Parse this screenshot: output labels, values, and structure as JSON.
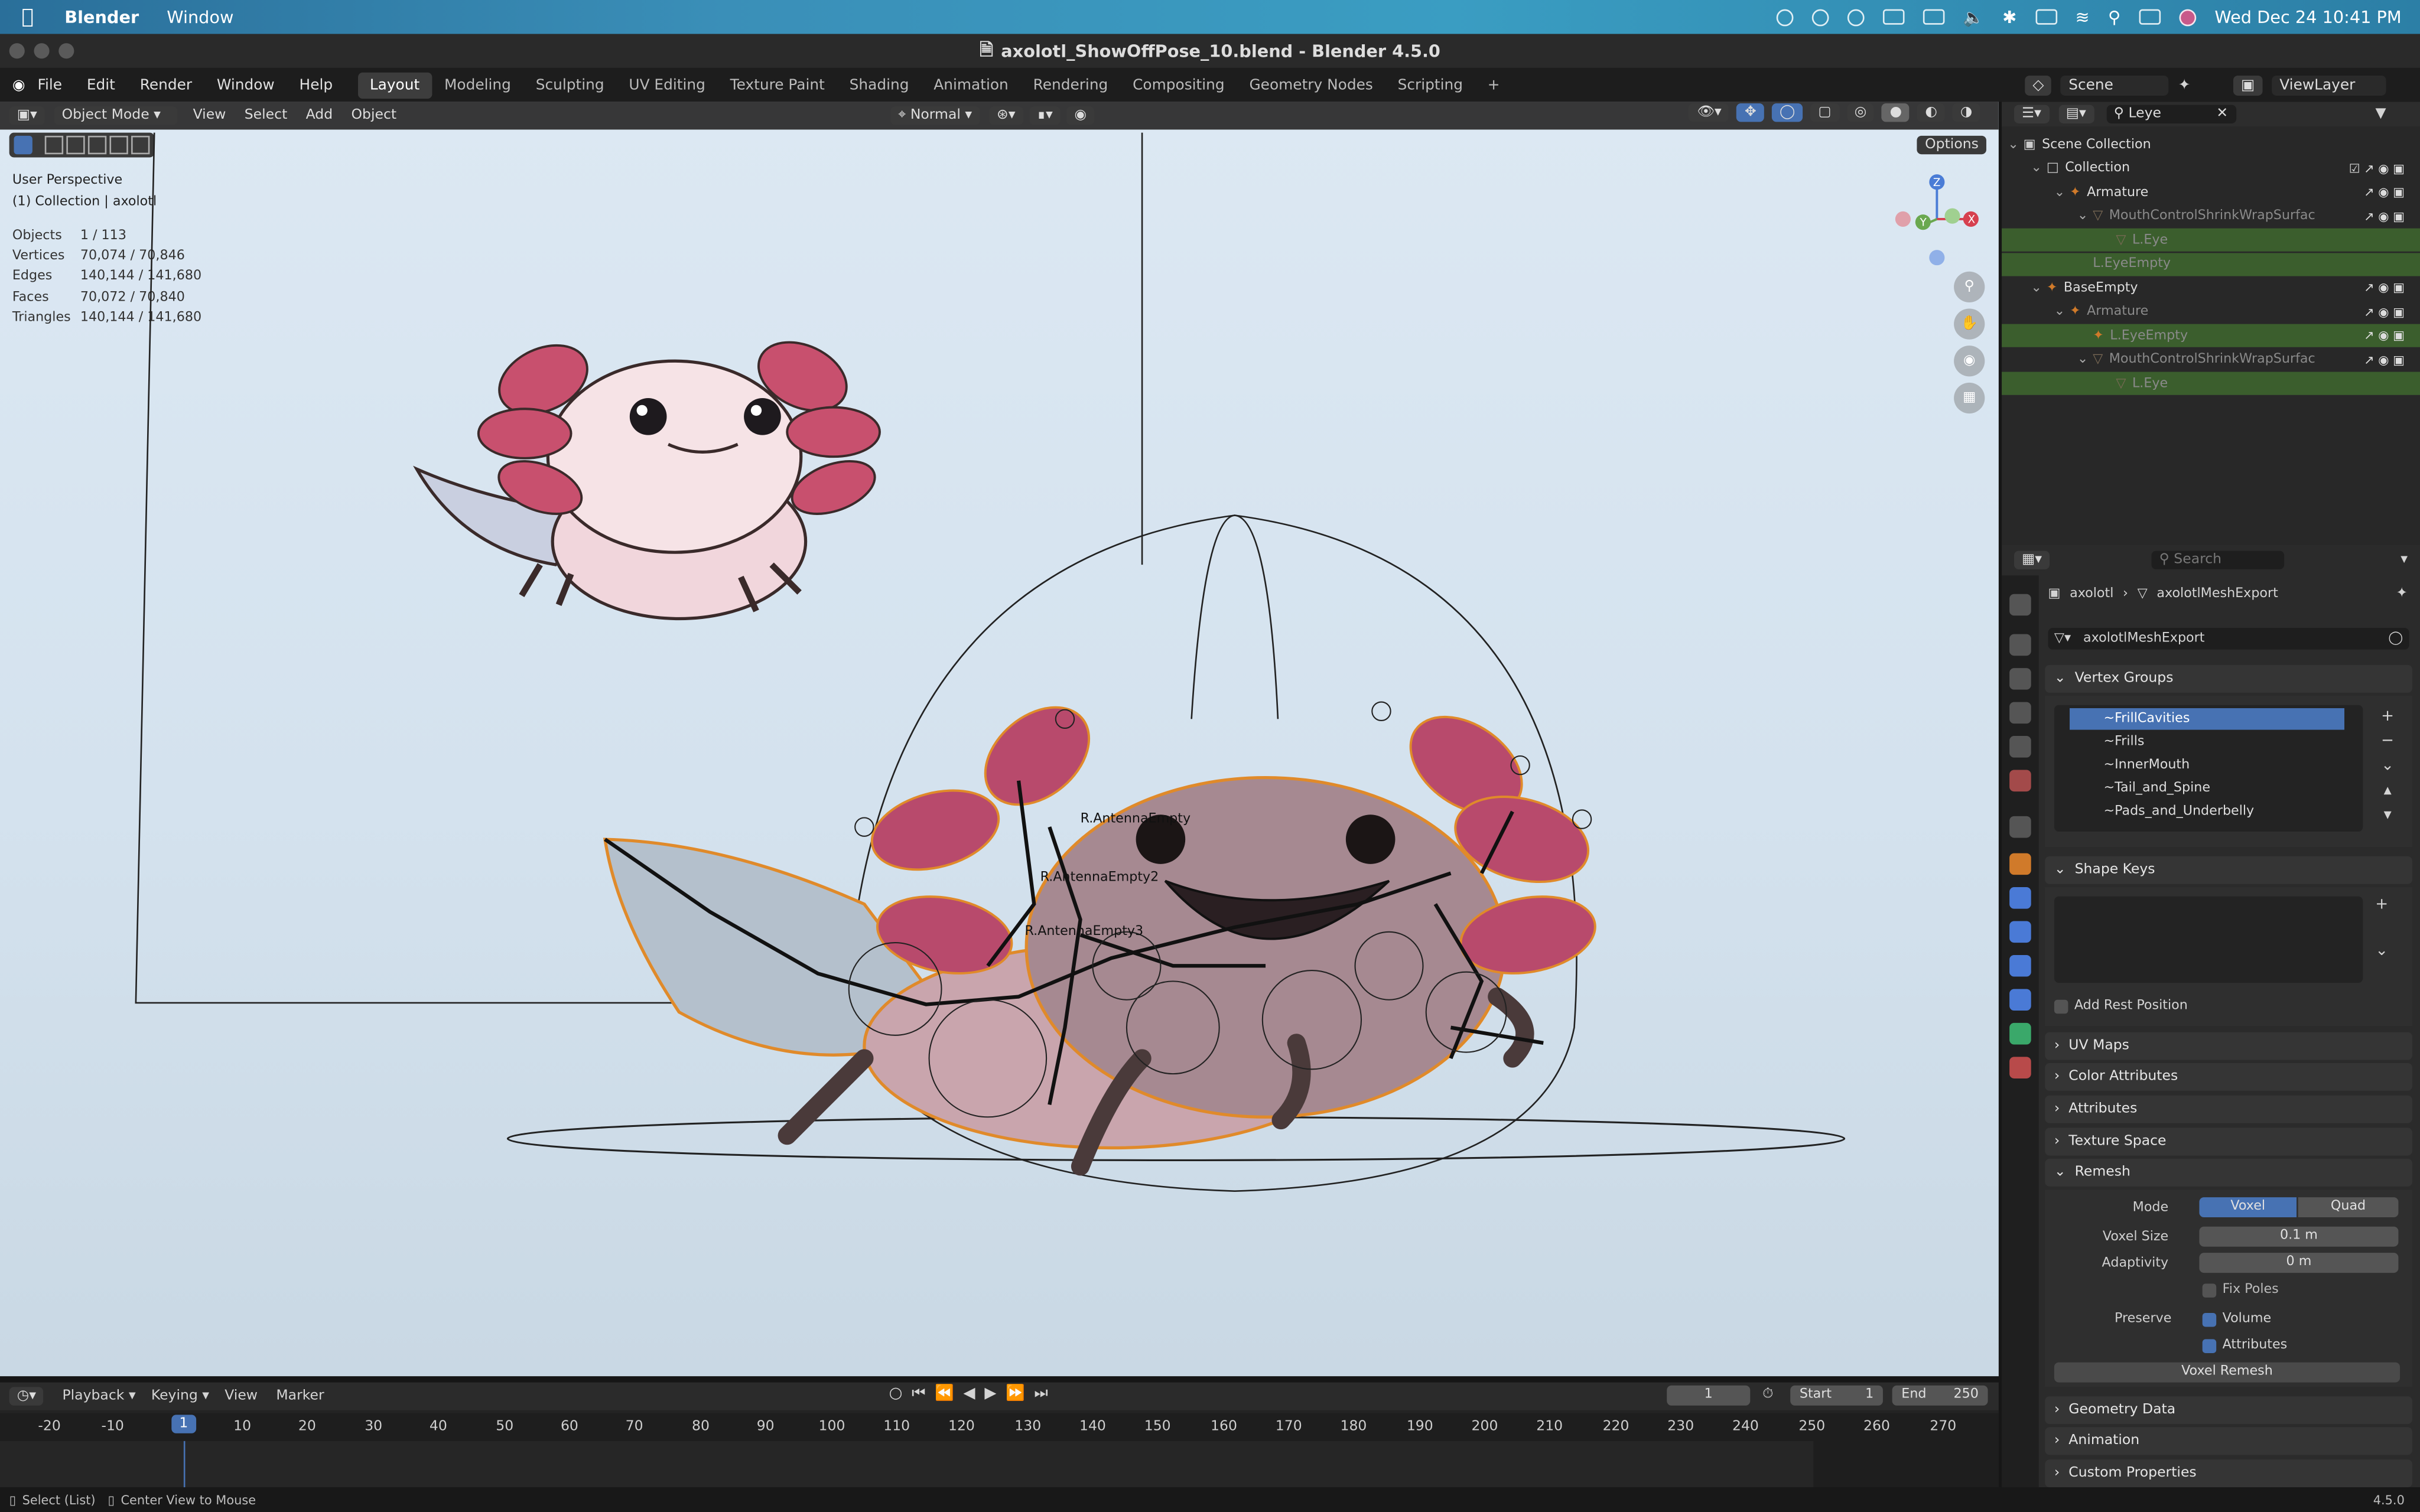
{
  "mac_menubar": {
    "apple": "",
    "app_name": "Blender",
    "menu": "Window",
    "clock": "Wed Dec 24  10:41 PM"
  },
  "window": {
    "title": "axolotl_ShowOffPose_10.blend - Blender 4.5.0"
  },
  "topbar": {
    "menus": [
      "File",
      "Edit",
      "Render",
      "Window",
      "Help"
    ],
    "workspaces": [
      "Layout",
      "Modeling",
      "Sculpting",
      "UV Editing",
      "Texture Paint",
      "Shading",
      "Animation",
      "Rendering",
      "Compositing",
      "Geometry Nodes",
      "Scripting"
    ],
    "active_workspace": "Layout",
    "add_tab": "+",
    "scene_label": "Scene",
    "viewlayer_label": "ViewLayer"
  },
  "viewport": {
    "mode": "Object Mode",
    "menus": [
      "View",
      "Select",
      "Add",
      "Object"
    ],
    "orientation": "Normal",
    "options": "Options",
    "overlay_title": "User Perspective",
    "overlay_collection": "(1) Collection | axolotl",
    "stats": [
      {
        "label": "Objects",
        "value": "1 / 113"
      },
      {
        "label": "Vertices",
        "value": "70,074 / 70,846"
      },
      {
        "label": "Edges",
        "value": "140,144 / 141,680"
      },
      {
        "label": "Faces",
        "value": "70,072 / 70,840"
      },
      {
        "label": "Triangles",
        "value": "140,144 / 141,680"
      }
    ],
    "gizmo": {
      "z": "Z",
      "y": "Y",
      "x": "X"
    },
    "bone_labels": [
      "R.AntennaEmpty",
      "R.AntennaEmpty2",
      "R.AntennaEmpty3"
    ]
  },
  "outliner": {
    "search_value": "Leye",
    "rows": [
      {
        "label": "Scene Collection",
        "indent": 0,
        "style": "",
        "icon": "scene-collection-icon"
      },
      {
        "label": "Collection",
        "indent": 1,
        "style": "",
        "icon": "collection-icon"
      },
      {
        "label": "Armature",
        "indent": 2,
        "style": "",
        "icon": "armature-icon"
      },
      {
        "label": "MouthControlShrinkWrapSurfac",
        "indent": 3,
        "style": "dim",
        "icon": "mesh-icon"
      },
      {
        "label": "L.Eye",
        "indent": 4,
        "style": "hl dim",
        "icon": "mesh-icon"
      },
      {
        "label": "L.EyeEmpty",
        "indent": 3,
        "style": "hl dim",
        "icon": ""
      },
      {
        "label": "BaseEmpty",
        "indent": 1,
        "style": "",
        "icon": "empty-icon"
      },
      {
        "label": "Armature",
        "indent": 2,
        "style": "dim",
        "icon": "armature-icon"
      },
      {
        "label": "L.EyeEmpty",
        "indent": 3,
        "style": "hl dim",
        "icon": "empty-icon"
      },
      {
        "label": "MouthControlShrinkWrapSurfac",
        "indent": 3,
        "style": "dim",
        "icon": "mesh-icon"
      },
      {
        "label": "L.Eye",
        "indent": 4,
        "style": "hl dim",
        "icon": "mesh-icon"
      }
    ]
  },
  "properties": {
    "search_placeholder": "Search",
    "breadcrumb_object": "axolotl",
    "breadcrumb_data": "axolotlMeshExport",
    "mesh_name": "axolotlMeshExport",
    "vertex_groups_title": "Vertex Groups",
    "vertex_groups": [
      "~FrillCavities",
      "~Frills",
      "~InnerMouth",
      "~Tail_and_Spine",
      "~Pads_and_Underbelly"
    ],
    "shape_keys_title": "Shape Keys",
    "add_rest_position": "Add Rest Position",
    "uv_maps": "UV Maps",
    "color_attributes": "Color Attributes",
    "attributes": "Attributes",
    "texture_space": "Texture Space",
    "remesh_title": "Remesh",
    "mode_label": "Mode",
    "mode_voxel": "Voxel",
    "mode_quad": "Quad",
    "voxel_size_label": "Voxel Size",
    "voxel_size_value": "0.1 m",
    "adaptivity_label": "Adaptivity",
    "adaptivity_value": "0 m",
    "fix_poles": "Fix Poles",
    "preserve_label": "Preserve",
    "preserve_volume": "Volume",
    "preserve_attributes": "Attributes",
    "voxel_remesh_button": "Voxel Remesh",
    "geometry_data": "Geometry Data",
    "animation": "Animation",
    "custom_properties": "Custom Properties"
  },
  "timeline": {
    "menus": [
      "Playback",
      "Keying",
      "View",
      "Marker"
    ],
    "current_frame": "1",
    "start_label": "Start",
    "start_value": "1",
    "end_label": "End",
    "end_value": "250",
    "ticks": [
      "-20",
      "-10",
      "1",
      "10",
      "20",
      "30",
      "40",
      "50",
      "60",
      "70",
      "80",
      "90",
      "100",
      "110",
      "120",
      "130",
      "140",
      "150",
      "160",
      "170",
      "180",
      "190",
      "200",
      "210",
      "220",
      "230",
      "240",
      "250",
      "260",
      "270"
    ]
  },
  "statusbar": {
    "hint1": "Select (List)",
    "hint2": "Center View to Mouse",
    "version": "4.5.0"
  }
}
